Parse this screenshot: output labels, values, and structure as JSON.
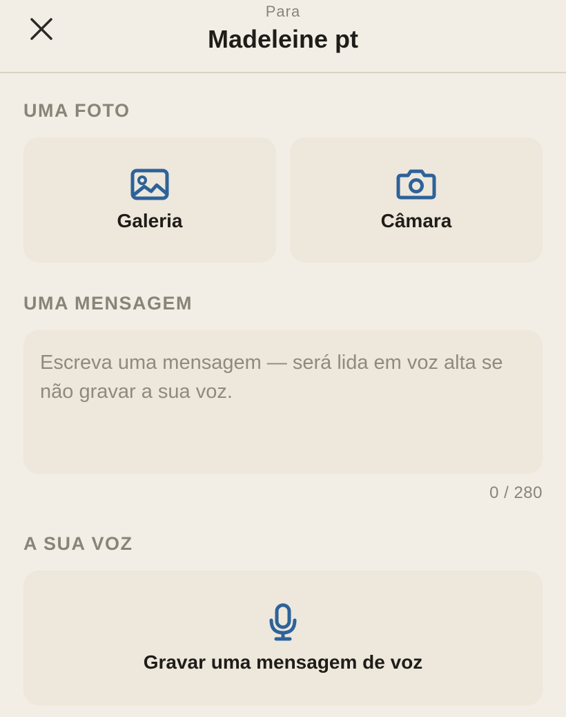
{
  "header": {
    "subtitle": "Para",
    "title": "Madeleine pt",
    "close_icon": "close-icon"
  },
  "photo_section": {
    "label": "UMA FOTO",
    "gallery": {
      "label": "Galeria",
      "icon": "image-icon"
    },
    "camera": {
      "label": "Câmara",
      "icon": "camera-icon"
    }
  },
  "message_section": {
    "label": "UMA MENSAGEM",
    "placeholder": "Escreva uma mensagem — será lida em voz alta se não gravar a sua voz.",
    "value": "",
    "counter": "0 / 280"
  },
  "voice_section": {
    "label": "A SUA VOZ",
    "record_label": "Gravar uma mensagem de voz",
    "icon": "microphone-icon"
  },
  "colors": {
    "background": "#f2eee6",
    "tile": "#ede7dc",
    "accent_icon": "#2d6299",
    "muted_text": "#8a8477",
    "title_text": "#1f1d19"
  }
}
